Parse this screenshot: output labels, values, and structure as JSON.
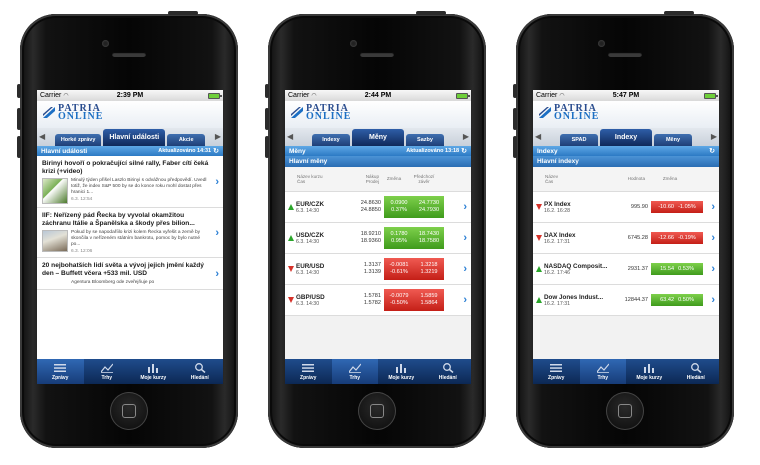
{
  "phones": [
    {
      "status": {
        "carrier": "Carrier",
        "time": "2:39 PM"
      },
      "logo": {
        "line1": "PATRIA",
        "line2": "ONLINE"
      },
      "tabs": [
        {
          "label": "Horké zprávy"
        },
        {
          "label": "Hlavní události",
          "active": true
        },
        {
          "label": "Akcie"
        }
      ],
      "section": {
        "title": "Hlavní události",
        "updated": "Aktualizováno 14:31"
      },
      "news": [
        {
          "headline": "Birinyi hovoří o pokračující silné rally, Faber cítí čeká krizi (+video)",
          "text": "Minulý týden přišel Laszlo Birinyi s odvážnou předpovědí. Uvedl totiž, že index S&P 500 by se do konce roku mohl dostat přes hranici 1...",
          "date": "6.3. 12:54"
        },
        {
          "headline": "IIF: Neřízený pád Řecka by vyvolal okamžitou záchranu Itálie a Španělska a škody přes bilion...",
          "text": "Pokud by se napodaříilo krizi kolem Řecka vyřešit a země by skončila v neřízeném státním bankrotu, pomoc by bylo nutné po...",
          "date": "6.3. 12:06"
        },
        {
          "headline": "20 nejbohatších lidí světa a vývoj jejich jmění každý den – Buffett včera +533 mil. USD",
          "text": "Agentura Bloomberg ode zveřejňuje po",
          "date": ""
        }
      ],
      "tabbar": [
        {
          "label": "Zprávy",
          "icon": "news-icon",
          "active": true
        },
        {
          "label": "Trhy",
          "icon": "chart-icon"
        },
        {
          "label": "Moje kurzy",
          "icon": "bars-icon"
        },
        {
          "label": "Hledání",
          "icon": "search-icon"
        }
      ]
    },
    {
      "status": {
        "carrier": "Carrier",
        "time": "2:44 PM"
      },
      "logo": {
        "line1": "PATRIA",
        "line2": "ONLINE"
      },
      "tabs": [
        {
          "label": "Indexy"
        },
        {
          "label": "Měny",
          "active": true
        },
        {
          "label": "Sazby"
        }
      ],
      "section": {
        "title": "Měny",
        "updated": "Aktualizováno 13:18"
      },
      "subsection": "Hlavní měny",
      "headers": {
        "name": "Název kurzu\nČas",
        "bid": "Nákup\nProdej",
        "change": "Změna",
        "prev": "Předchozí\nzávěr"
      },
      "rows": [
        {
          "name": "EUR/CZK",
          "time": "6.3. 14:30",
          "bid": "24.8630",
          "ask": "24.8850",
          "chg1": "0.0900",
          "chg2": "0.37%",
          "prev1": "24.7730",
          "prev2": "24.7930",
          "dir": "up"
        },
        {
          "name": "USD/CZK",
          "time": "6.3. 14:30",
          "bid": "18.9210",
          "ask": "18.9360",
          "chg1": "0.1780",
          "chg2": "0.95%",
          "prev1": "18.7430",
          "prev2": "18.7580",
          "dir": "up"
        },
        {
          "name": "EUR/USD",
          "time": "6.3. 14:30",
          "bid": "1.3137",
          "ask": "1.3139",
          "chg1": "-0.0081",
          "chg2": "-0.61%",
          "prev1": "1.3218",
          "prev2": "1.3219",
          "dir": "down"
        },
        {
          "name": "GBP/USD",
          "time": "6.3. 14:30",
          "bid": "1.5781",
          "ask": "1.5782",
          "chg1": "-0.0079",
          "chg2": "-0.50%",
          "prev1": "1.5859",
          "prev2": "1.5864",
          "dir": "down"
        }
      ],
      "tabbar": [
        {
          "label": "Zprávy",
          "icon": "news-icon"
        },
        {
          "label": "Trhy",
          "icon": "chart-icon",
          "active": true
        },
        {
          "label": "Moje kurzy",
          "icon": "bars-icon"
        },
        {
          "label": "Hledání",
          "icon": "search-icon"
        }
      ]
    },
    {
      "status": {
        "carrier": "Carrier",
        "time": "5:47 PM"
      },
      "logo": {
        "line1": "PATRIA",
        "line2": "ONLINE"
      },
      "tabs": [
        {
          "label": "SPAD"
        },
        {
          "label": "Indexy",
          "active": true
        },
        {
          "label": "Měny"
        }
      ],
      "section": {
        "title": "Indexy",
        "updated": ""
      },
      "subsection": "Hlavní indexy",
      "headers": {
        "name": "Název\nČas",
        "value": "Hodnota",
        "change": "Změna"
      },
      "rows": [
        {
          "name": "PX Index",
          "time": "16.2. 16:28",
          "value": "995.90",
          "chg1": "-10.60",
          "chg2": "-1.05%",
          "dir": "down"
        },
        {
          "name": "DAX Index",
          "time": "16.2. 17:31",
          "value": "6745.28",
          "chg1": "-12.66",
          "chg2": "-0.19%",
          "dir": "down"
        },
        {
          "name": "NASDAQ Composit...",
          "time": "16.2. 17:46",
          "value": "2931.37",
          "chg1": "15.54",
          "chg2": "0.53%",
          "dir": "up"
        },
        {
          "name": "Dow Jones Indust...",
          "time": "16.2. 17:31",
          "value": "12844.37",
          "chg1": "63.42",
          "chg2": "0.50%",
          "dir": "up"
        }
      ],
      "tabbar": [
        {
          "label": "Zprávy",
          "icon": "news-icon"
        },
        {
          "label": "Trhy",
          "icon": "chart-icon",
          "active": true
        },
        {
          "label": "Moje kurzy",
          "icon": "bars-icon"
        },
        {
          "label": "Hledání",
          "icon": "search-icon"
        }
      ]
    }
  ],
  "colors": {
    "brand": "#1f3f77",
    "accent": "#2c7ac4",
    "up": "#3f9b1c",
    "down": "#c41f17"
  }
}
